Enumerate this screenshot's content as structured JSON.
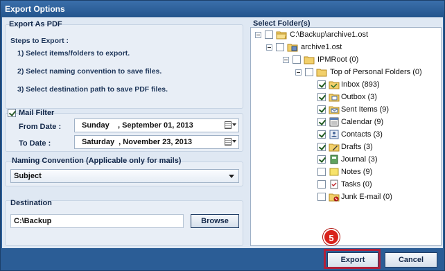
{
  "window": {
    "title": "Export Options"
  },
  "export_section": {
    "title": "Export As PDF",
    "steps_heading": "Steps to Export :",
    "steps": [
      "1) Select items/folders to export.",
      "2) Select naming convention to save files.",
      "3) Select destination path to save PDF files."
    ]
  },
  "mail_filter": {
    "label": "Mail Filter",
    "checked": true,
    "from_label": "From Date :",
    "from_value": "Sunday    , September 01, 2013",
    "to_label": "To Date :",
    "to_value": "Saturday  , November 23, 2013"
  },
  "naming": {
    "label": "Naming Convention (Applicable only for mails)",
    "selected": "Subject"
  },
  "destination": {
    "label": "Destination",
    "path": "C:\\Backup",
    "browse_label": "Browse"
  },
  "folders": {
    "label": "Select Folder(s)",
    "items": [
      {
        "label": "C:\\Backup\\archive1.ost",
        "icon": "folder-open-icon",
        "checked": false
      },
      {
        "label": "archive1.ost",
        "icon": "data-file-icon",
        "checked": false
      },
      {
        "label": "IPMRoot (0)",
        "icon": "folder-icon",
        "checked": false
      },
      {
        "label": "Top of Personal Folders (0)",
        "icon": "folder-icon",
        "checked": false
      },
      {
        "label": "Inbox (893)",
        "icon": "inbox-icon",
        "checked": true
      },
      {
        "label": "Outbox (3)",
        "icon": "outbox-icon",
        "checked": true
      },
      {
        "label": "Sent Items (9)",
        "icon": "sent-items-icon",
        "checked": true
      },
      {
        "label": "Calendar (9)",
        "icon": "calendar-icon",
        "checked": true
      },
      {
        "label": "Contacts (3)",
        "icon": "contacts-icon",
        "checked": true
      },
      {
        "label": "Drafts (3)",
        "icon": "drafts-icon",
        "checked": true
      },
      {
        "label": "Journal (3)",
        "icon": "journal-icon",
        "checked": true
      },
      {
        "label": "Notes (9)",
        "icon": "notes-icon",
        "checked": false
      },
      {
        "label": "Tasks (0)",
        "icon": "tasks-icon",
        "checked": false
      },
      {
        "label": "Junk E-mail (0)",
        "icon": "junk-email-icon",
        "checked": false
      }
    ]
  },
  "buttons": {
    "export_label": "Export",
    "cancel_label": "Cancel"
  },
  "step_badge": "5",
  "colors": {
    "title_bar": "#2b5d96",
    "panel": "#dfe8f3",
    "badge": "#d9211b",
    "highlight": "#b0203a"
  }
}
